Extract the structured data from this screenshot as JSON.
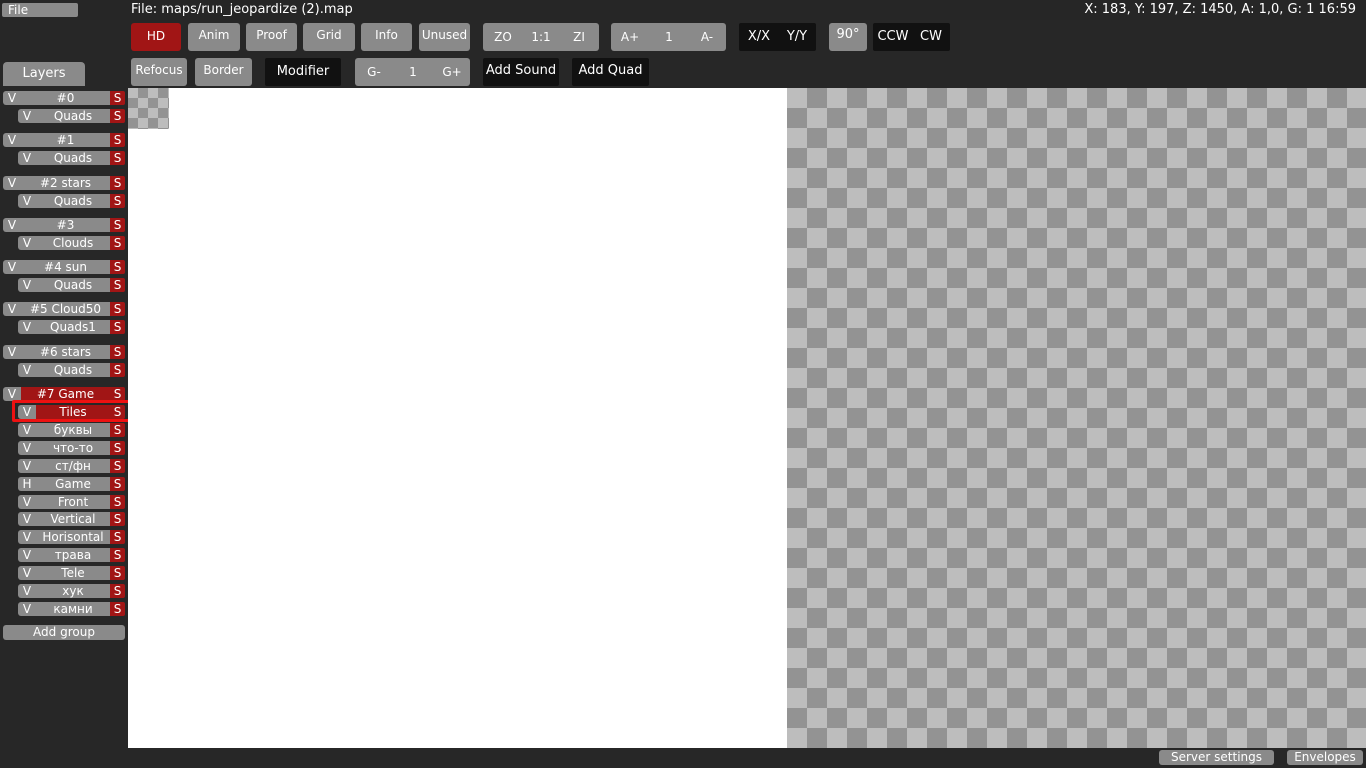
{
  "topbar": {
    "file_label": "File",
    "file_path": "File: maps/run_jeopardize (2).map",
    "status": "X: 183, Y: 197, Z: 1450, A: 1,0, G: 1  16:59"
  },
  "toolbar": {
    "hd": "HD",
    "anim": "Anim",
    "proof": "Proof",
    "grid": "Grid",
    "info": "Info",
    "unused": "Unused",
    "zoom_out": "ZO",
    "zoom_reset": "1:1",
    "zoom_in": "ZI",
    "anim_faster": "A+",
    "anim_speed": "1",
    "anim_slower": "A-",
    "flip_x": "X/X",
    "flip_y": "Y/Y",
    "rotate_90": "90°",
    "ccw": "CCW",
    "cw": "CW",
    "refocus": "Refocus",
    "border": "Border",
    "modifier": "Modifier",
    "grid_minus": "G-",
    "grid_factor": "1",
    "grid_plus": "G+",
    "add_sound": "Add Sound",
    "add_quad": "Add Quad"
  },
  "sidebar": {
    "tab_label": "Layers",
    "add_group_label": "Add group",
    "groups": [
      {
        "toggle": "V",
        "name": "#0",
        "solo": "S",
        "layers": [
          {
            "toggle": "V",
            "name": "Quads",
            "solo": "S"
          }
        ]
      },
      {
        "toggle": "V",
        "name": "#1",
        "solo": "S",
        "layers": [
          {
            "toggle": "V",
            "name": "Quads",
            "solo": "S"
          }
        ]
      },
      {
        "toggle": "V",
        "name": "#2 stars",
        "solo": "S",
        "layers": [
          {
            "toggle": "V",
            "name": "Quads",
            "solo": "S"
          }
        ]
      },
      {
        "toggle": "V",
        "name": "#3",
        "solo": "S",
        "layers": [
          {
            "toggle": "V",
            "name": "Clouds",
            "solo": "S"
          }
        ]
      },
      {
        "toggle": "V",
        "name": "#4 sun",
        "solo": "S",
        "layers": [
          {
            "toggle": "V",
            "name": "Quads",
            "solo": "S"
          }
        ]
      },
      {
        "toggle": "V",
        "name": "#5 Cloud50",
        "solo": "S",
        "layers": [
          {
            "toggle": "V",
            "name": "Quads1",
            "solo": "S"
          }
        ]
      },
      {
        "toggle": "V",
        "name": "#6 stars",
        "solo": "S",
        "layers": [
          {
            "toggle": "V",
            "name": "Quads",
            "solo": "S"
          }
        ]
      },
      {
        "toggle": "V",
        "name": "#7 Game",
        "solo": "S",
        "layers": [
          {
            "toggle": "V",
            "name": "Tiles",
            "solo": "S"
          },
          {
            "toggle": "V",
            "name": "буквы",
            "solo": "S"
          },
          {
            "toggle": "V",
            "name": "что-то",
            "solo": "S"
          },
          {
            "toggle": "V",
            "name": "ст/фн",
            "solo": "S"
          },
          {
            "toggle": "H",
            "name": "Game",
            "solo": "S"
          },
          {
            "toggle": "V",
            "name": "Front",
            "solo": "S"
          },
          {
            "toggle": "V",
            "name": "Vertical",
            "solo": "S"
          },
          {
            "toggle": "V",
            "name": "Horisontal",
            "solo": "S"
          },
          {
            "toggle": "V",
            "name": "трава",
            "solo": "S"
          },
          {
            "toggle": "V",
            "name": "Tele",
            "solo": "S"
          },
          {
            "toggle": "V",
            "name": "хук",
            "solo": "S"
          },
          {
            "toggle": "V",
            "name": "камни",
            "solo": "S"
          }
        ]
      }
    ]
  },
  "bottom": {
    "server_settings": "Server settings",
    "envelopes": "Envelopes"
  }
}
